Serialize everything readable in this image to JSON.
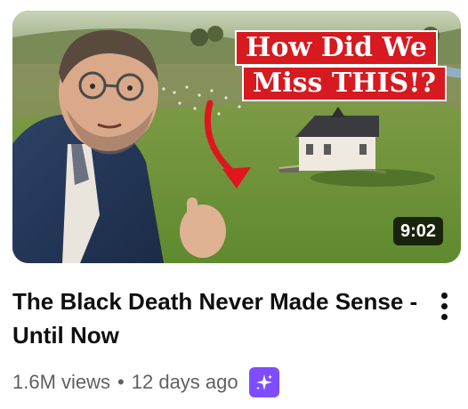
{
  "video": {
    "thumbnail_caption_line1": "How Did We",
    "thumbnail_caption_line2": "Miss THIS!?",
    "duration": "9:02",
    "title": "The Black Death Never Made Sense - Until Now",
    "views": "1.6M views",
    "separator": "•",
    "age": "12 days ago"
  },
  "icons": {
    "menu": "more-vertical-icon",
    "badge": "sparkle-icon"
  },
  "colors": {
    "caption_bg": "#d71920",
    "badge_bg": "#7d4dff",
    "meta_text": "#606060",
    "title_text": "#0f0f0f"
  }
}
